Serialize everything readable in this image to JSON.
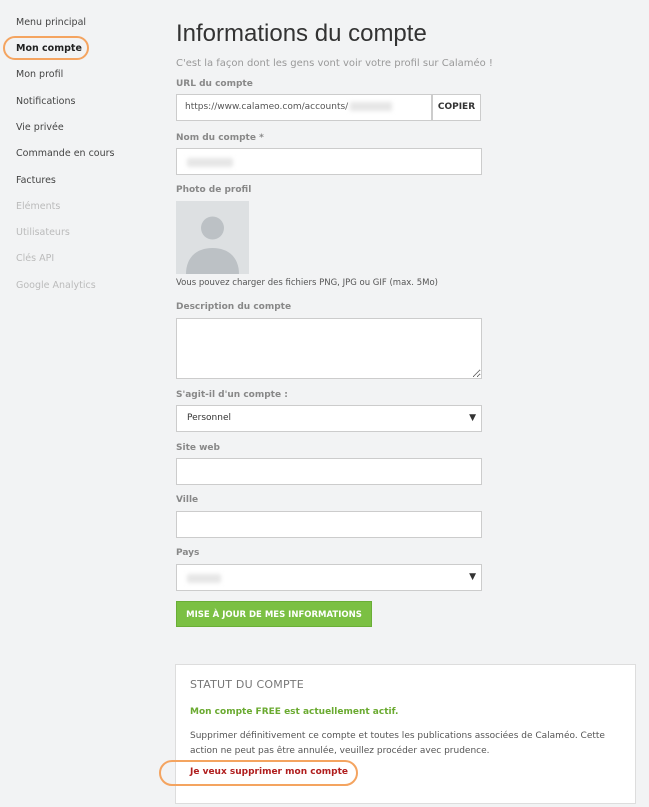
{
  "sidebar": {
    "items": [
      {
        "label": "Menu principal",
        "state": "normal"
      },
      {
        "label": "Mon compte",
        "state": "active"
      },
      {
        "label": "Mon profil",
        "state": "normal"
      },
      {
        "label": "Notifications",
        "state": "normal"
      },
      {
        "label": "Vie privée",
        "state": "normal"
      },
      {
        "label": "Commande en cours",
        "state": "normal"
      },
      {
        "label": "Factures",
        "state": "normal"
      },
      {
        "label": "Eléments",
        "state": "disabled"
      },
      {
        "label": "Utilisateurs",
        "state": "disabled"
      },
      {
        "label": "Clés API",
        "state": "disabled"
      },
      {
        "label": "Google Analytics",
        "state": "disabled"
      }
    ]
  },
  "page": {
    "title": "Informations du compte",
    "subtitle": "C'est la façon dont les gens vont voir votre profil sur Calaméo !"
  },
  "form": {
    "url_label": "URL du compte",
    "url_value": "https://www.calameo.com/accounts/",
    "copy_label": "COPIER",
    "name_label": "Nom du compte *",
    "photo_label": "Photo de profil",
    "photo_hint": "Vous pouvez charger des fichiers PNG, JPG ou GIF (max. 5Mo)",
    "desc_label": "Description du compte",
    "type_label": "S'agit-il d'un compte :",
    "type_value": "Personnel",
    "site_label": "Site web",
    "city_label": "Ville",
    "country_label": "Pays",
    "submit_label": "MISE À JOUR DE MES INFORMATIONS"
  },
  "status": {
    "title": "STATUT DU COMPTE",
    "active_text": "Mon compte FREE est actuellement actif.",
    "warning_text": "Supprimer définitivement ce compte et toutes les publications associées de Calaméo. Cette action ne peut pas être annulée, veuillez procéder avec prudence.",
    "delete_link": "Je veux supprimer mon compte"
  },
  "colors": {
    "accent_green": "#7bc043",
    "danger_red": "#b01e1e",
    "highlight_orange": "#f4a460"
  },
  "icons": {
    "avatar": "user-silhouette-icon",
    "select_caret": "caret-down-icon"
  }
}
